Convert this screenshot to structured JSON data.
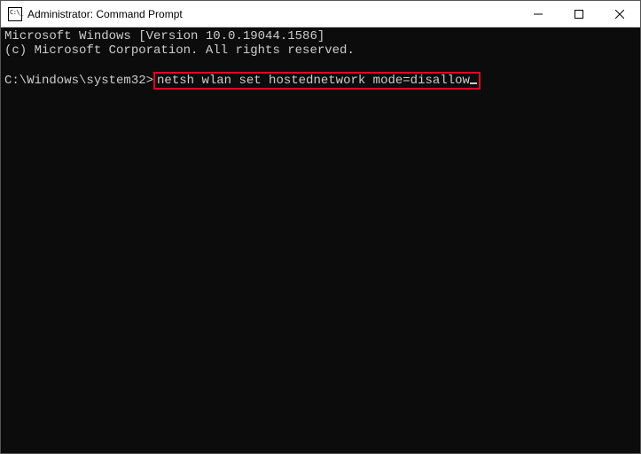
{
  "window": {
    "title": "Administrator: Command Prompt"
  },
  "console": {
    "line1": "Microsoft Windows [Version 10.0.19044.1586]",
    "line2": "(c) Microsoft Corporation. All rights reserved.",
    "prompt": "C:\\Windows\\system32>",
    "command": "netsh wlan set hostednetwork mode=disallow"
  }
}
